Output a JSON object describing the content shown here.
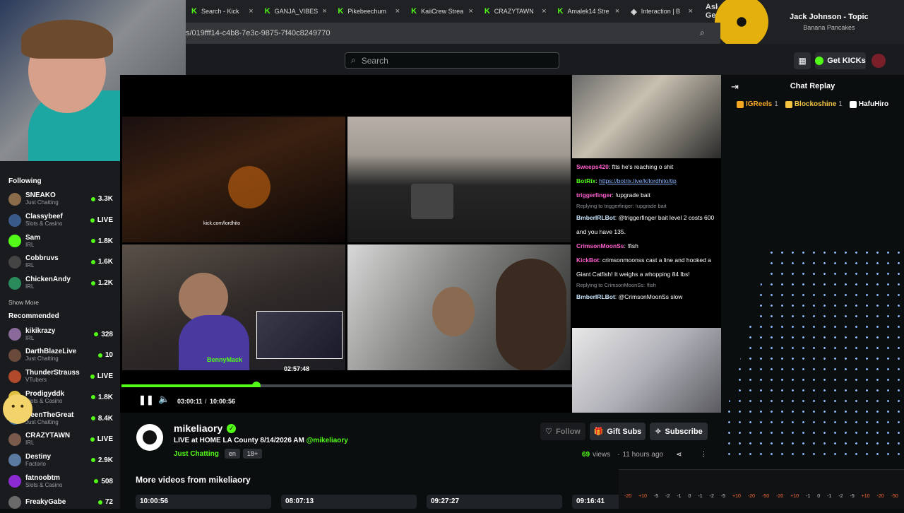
{
  "browser": {
    "tabs": [
      {
        "label": "Search - Kick",
        "icon": "kick-icon"
      },
      {
        "label": "GANJA_VIBES",
        "icon": "kick-icon"
      },
      {
        "label": "Pikebeechum",
        "icon": "kick-icon"
      },
      {
        "label": "KaiiCrew Strea",
        "icon": "kick-icon"
      },
      {
        "label": "CRAZYTAWN",
        "icon": "kick-icon"
      },
      {
        "label": "Amalek14 Stre",
        "icon": "kick-icon"
      },
      {
        "label": "Interaction | B",
        "icon": "shield-icon"
      }
    ],
    "ask_gemini": "Ask Gemini",
    "url": "s/019fff14-c4b8-7e3c-9875-7f40c8249770"
  },
  "media": {
    "title": "Jack Johnson - Topic",
    "subtitle": "Banana Pancakes"
  },
  "nav": {
    "search_placeholder": "Search",
    "kicks_label": "Get KICKs"
  },
  "sidebar": {
    "following_title": "Following",
    "show_more": "Show More",
    "recommended_title": "Recommended",
    "following": [
      {
        "name": "SNEAKO",
        "category": "Just Chatting",
        "viewers": "3.3K",
        "color": "#8a6b4a"
      },
      {
        "name": "Classybeef",
        "category": "Slots & Casino",
        "viewers": "LIVE",
        "color": "#3a5a8a"
      },
      {
        "name": "Sam",
        "category": "IRL",
        "viewers": "1.8K",
        "color": "#53fc18"
      },
      {
        "name": "Cobbruvs",
        "category": "IRL",
        "viewers": "1.6K",
        "color": "#444"
      },
      {
        "name": "ChickenAndy",
        "category": "IRL",
        "viewers": "1.2K",
        "color": "#2a8a5a"
      }
    ],
    "recommended": [
      {
        "name": "kikikrazy",
        "category": "IRL",
        "viewers": "328",
        "color": "#8a6a9a"
      },
      {
        "name": "DarthBlazeLive",
        "category": "Just Chatting",
        "viewers": "10",
        "color": "#6a4a3a"
      },
      {
        "name": "ThunderStrauss",
        "category": "VTubers",
        "viewers": "LIVE",
        "color": "#b04a2a"
      },
      {
        "name": "Prodigyddk",
        "category": "Slots & Casino",
        "viewers": "1.8K",
        "color": "#e0c040"
      },
      {
        "name": "DeenTheGreat",
        "category": "Just Chatting",
        "viewers": "8.4K",
        "color": "#3a6aa0"
      },
      {
        "name": "CRAZYTAWN",
        "category": "IRL",
        "viewers": "LIVE",
        "color": "#7a5a4a"
      },
      {
        "name": "Destiny",
        "category": "Factorio",
        "viewers": "2.9K",
        "color": "#5a7aa0"
      },
      {
        "name": "fatnoobtm",
        "category": "Slots & Casino",
        "viewers": "508",
        "color": "#8a2ad0"
      },
      {
        "name": "FreakyGabe",
        "category": "",
        "viewers": "72",
        "color": "#6a6a6a"
      }
    ]
  },
  "player": {
    "current": "03:00:11",
    "separator": "/",
    "duration": "10:00:56",
    "progress": 0.3,
    "preview_time": "02:57:48",
    "overlay_watermark": "BennyMack",
    "overlay_handle": "kick.com/lordhito"
  },
  "chat": {
    "messages": [
      {
        "user": "Sweeps420",
        "color": "#ff5fd0",
        "text": "ftts he's reaching o shit"
      },
      {
        "user": "BotRix",
        "color": "#53fc18",
        "text": "https://botrix.live/k/lordhito/tip"
      },
      {
        "user": "triggerfinger",
        "color": "#ff5fd0",
        "text": "!upgrade bait"
      },
      {
        "reply": "Replying to triggerfinger: !upgrade bait"
      },
      {
        "user": "BmberIRLBot",
        "color": "#c9e7ff",
        "text": "@triggerfinger bait level 2 costs 600 and you have 135."
      },
      {
        "user": "CrimsonMoonSs",
        "color": "#ff5fd0",
        "text": "!fish"
      },
      {
        "user": "KickBot",
        "color": "#ff5fd0",
        "text": "crimsonmoonss cast a line and hooked a Giant Catfish! It weighs a whopping 84 lbs!"
      },
      {
        "reply": "Replying to CrimsonMoonSs: !fish"
      },
      {
        "user": "BmberIRLBot",
        "color": "#c9e7ff",
        "text": "@CrimsonMoonSs slow"
      }
    ]
  },
  "replay": {
    "title": "Chat Replay",
    "gifters": [
      {
        "name": "IGReels",
        "count": "1",
        "color": "#f5a623"
      },
      {
        "name": "Blockoshine",
        "count": "1",
        "color": "#f5c542"
      },
      {
        "name": "HafuHiro",
        "count": "",
        "color": "#fff"
      }
    ]
  },
  "channel": {
    "name": "mikeliaory",
    "title": "LIVE at HOME LA County 8/14/2026 AM",
    "handle": "@mikeliaory",
    "category": "Just Chatting",
    "tags": [
      "en",
      "18+"
    ],
    "follow": "Follow",
    "gift": "Gift Subs",
    "subscribe": "Subscribe",
    "views": "69",
    "views_label": "views",
    "ago": "11 hours ago"
  },
  "more": {
    "title": "More videos from mikeliaory",
    "thumbs": [
      "10:00:56",
      "08:07:13",
      "09:27:27",
      "09:16:41"
    ]
  },
  "meter": {
    "labels": [
      "-20",
      "+10",
      "-5",
      "-2",
      "-1",
      "0",
      "-1",
      "-2",
      "-5",
      "+10",
      "-20",
      "-50",
      "-20",
      "+10",
      "-1",
      "0",
      "-1",
      "-2",
      "-5",
      "+10",
      "-20",
      "-50"
    ]
  },
  "colors": {
    "accent": "#53fc18",
    "bg": "#0b0e0f",
    "panel": "#191b1f"
  }
}
